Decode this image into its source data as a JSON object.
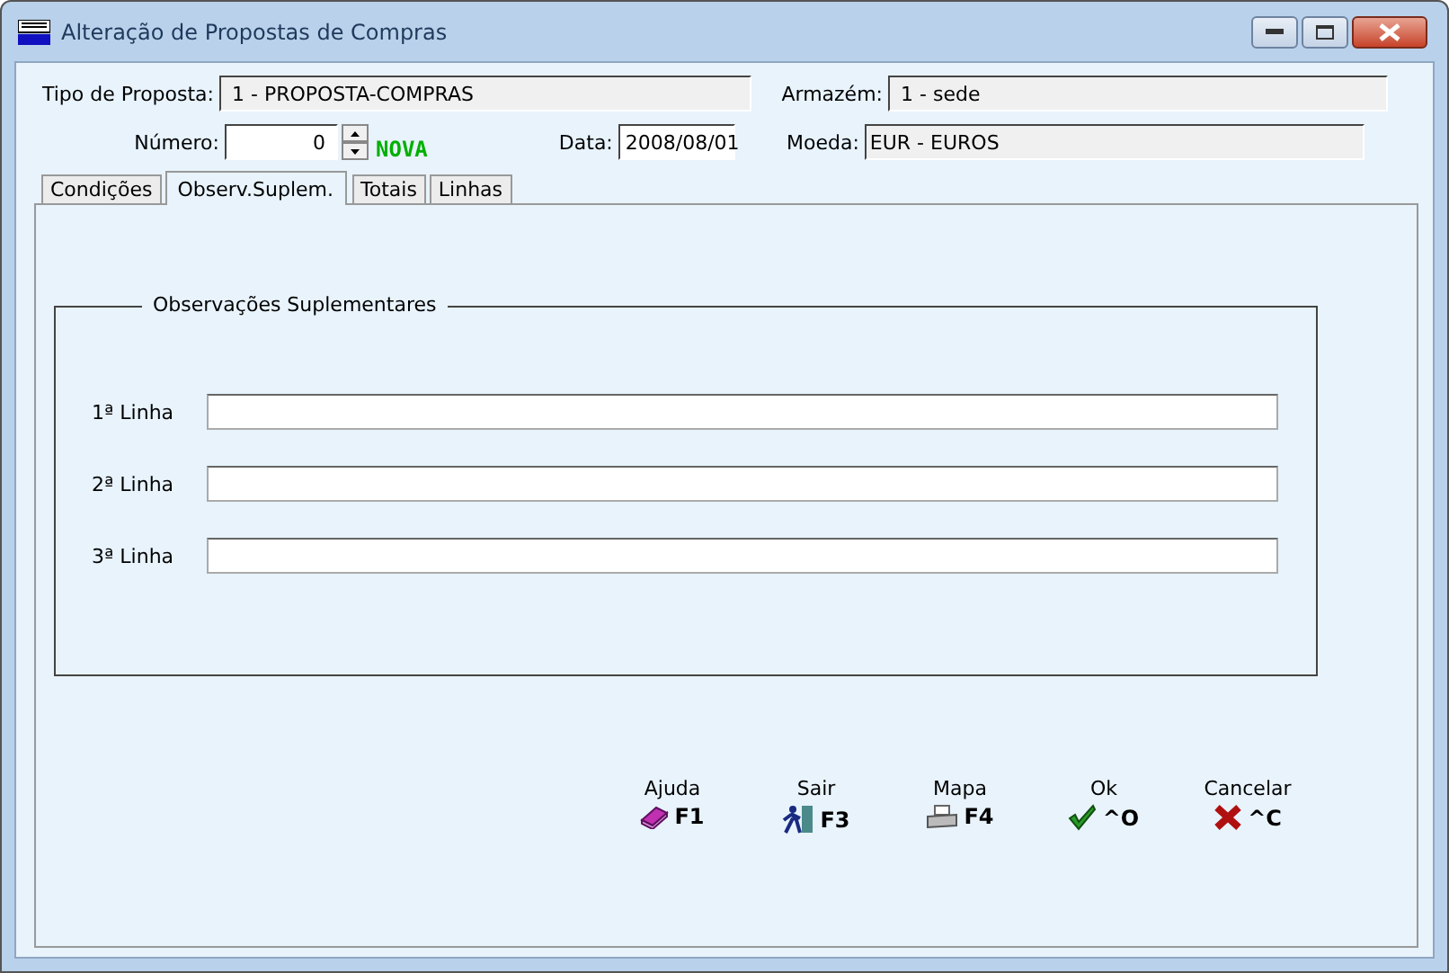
{
  "window": {
    "title": "Alteração de Propostas de Compras"
  },
  "header": {
    "tipo_label": "Tipo de Proposta:",
    "tipo_value": "1 - PROPOSTA-COMPRAS",
    "armazem_label": "Armazém:",
    "armazem_value": "1 - sede",
    "numero_label": "Número:",
    "numero_value": "0",
    "status": "NOVA",
    "data_label": "Data:",
    "data_value": "2008/08/01",
    "moeda_label": "Moeda:",
    "moeda_value": "EUR - EUROS"
  },
  "tabs": [
    {
      "label": "Condições",
      "selected": false
    },
    {
      "label": "Observ.Suplem.",
      "selected": true
    },
    {
      "label": "Totais",
      "selected": false
    },
    {
      "label": "Linhas",
      "selected": false
    }
  ],
  "group": {
    "title": "Observações Suplementares",
    "lines": [
      {
        "label": "1ª Linha"
      },
      {
        "label": "2ª Linha"
      },
      {
        "label": "3ª Linha"
      }
    ]
  },
  "buttons": [
    {
      "label": "Ajuda",
      "key": "F1",
      "kind": "help"
    },
    {
      "label": "Sair",
      "key": "F3",
      "kind": "exit"
    },
    {
      "label": "Mapa",
      "key": "F4",
      "kind": "print"
    },
    {
      "label": "Ok",
      "key": "^O",
      "kind": "ok"
    },
    {
      "label": "Cancelar",
      "key": "^C",
      "kind": "cancel"
    }
  ]
}
